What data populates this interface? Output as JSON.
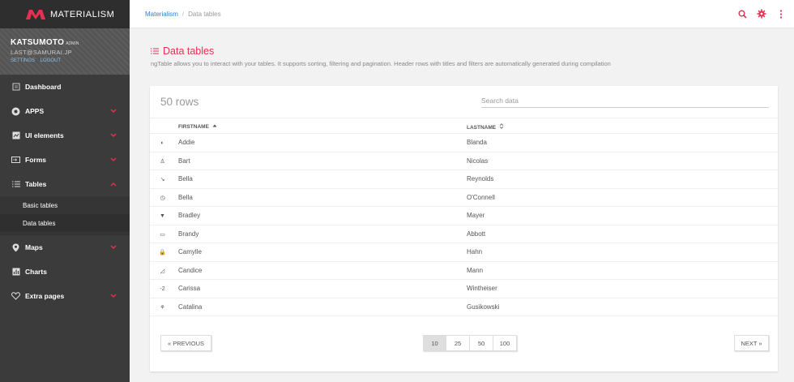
{
  "brand": {
    "name": "MATERIALISM",
    "color": "#e5304f"
  },
  "profile": {
    "name": "KATSUMOTO",
    "role": "ADMIN",
    "email": "LAST@SAMURAI.JP",
    "settings_label": "SETTINGS",
    "logout_label": "LOGOUT"
  },
  "sidebar": {
    "items": [
      {
        "label": "Dashboard",
        "icon": "dashboard-icon"
      },
      {
        "label": "APPS",
        "icon": "apps-icon"
      },
      {
        "label": "UI elements",
        "icon": "ui-elements-icon"
      },
      {
        "label": "Forms",
        "icon": "forms-icon"
      },
      {
        "label": "Tables",
        "icon": "tables-icon"
      },
      {
        "label": "Maps",
        "icon": "map-pin-icon"
      },
      {
        "label": "Charts",
        "icon": "charts-icon"
      },
      {
        "label": "Extra pages",
        "icon": "heart-icon"
      }
    ],
    "sub_items": [
      {
        "label": "Basic tables"
      },
      {
        "label": "Data tables",
        "active": true
      }
    ]
  },
  "breadcrumb": {
    "home": "Materialism",
    "separator": "/",
    "current": "Data tables"
  },
  "page": {
    "title": "Data tables",
    "description": "ngTable allows you to interact with your tables. It supports sorting, filtering and pagination. Header rows with titles and filters are automatically generated during compilation"
  },
  "table": {
    "rows_count": "50 rows",
    "search_placeholder": "Search data",
    "columns": [
      {
        "label": "FIRSTNAME",
        "sort": "asc"
      },
      {
        "label": "LASTNAME",
        "sort": "none"
      }
    ],
    "rows": [
      {
        "icon": "◐",
        "first": "Addie",
        "last": "Blanda"
      },
      {
        "icon": "♙",
        "first": "Bart",
        "last": "Nicolas"
      },
      {
        "icon": "↘",
        "first": "Bella",
        "last": "Reynolds"
      },
      {
        "icon": "◷",
        "first": "Bella",
        "last": "O'Connell"
      },
      {
        "icon": "▼",
        "first": "Bradley",
        "last": "Mayer"
      },
      {
        "icon": "▭",
        "first": "Brandy",
        "last": "Abbott"
      },
      {
        "icon": "🔒",
        "first": "Camylle",
        "last": "Hahn"
      },
      {
        "icon": "◿",
        "first": "Candice",
        "last": "Mann"
      },
      {
        "icon": "-2",
        "first": "Carissa",
        "last": "Wintheiser"
      },
      {
        "icon": "⚘",
        "first": "Catalina",
        "last": "Gusikowski"
      }
    ]
  },
  "pagination": {
    "previous": "« PREVIOUS",
    "next": "NEXT »",
    "sizes": [
      "10",
      "25",
      "50",
      "100"
    ],
    "active_size": "10"
  }
}
